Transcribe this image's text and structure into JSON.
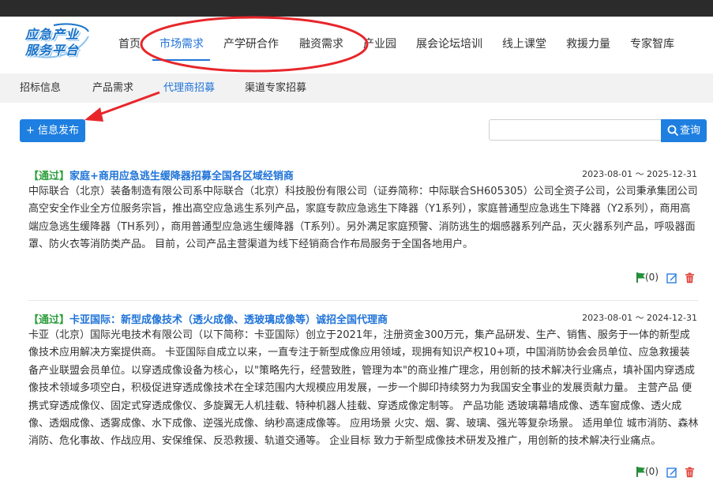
{
  "logo": {
    "line1": "应急产业",
    "line2": "服务平台"
  },
  "nav": {
    "items": [
      {
        "label": "首页"
      },
      {
        "label": "市场需求",
        "active": true
      },
      {
        "label": "产学研合作"
      },
      {
        "label": "融资需求"
      },
      {
        "label": "产业园"
      },
      {
        "label": "展会论坛培训"
      },
      {
        "label": "线上课堂"
      },
      {
        "label": "救援力量"
      },
      {
        "label": "专家智库"
      }
    ]
  },
  "subnav": {
    "items": [
      {
        "label": "招标信息"
      },
      {
        "label": "产品需求"
      },
      {
        "label": "代理商招募",
        "active": true
      },
      {
        "label": "渠道专家招募"
      }
    ]
  },
  "toolbar": {
    "publish_label": "+ 信息发布",
    "search_placeholder": "",
    "search_value": "",
    "search_label": "查询"
  },
  "listings": [
    {
      "status": "【通过】",
      "title": "家庭+商用应急逃生缓降器招募全国各区域经销商",
      "date_range": "2023-08-01 ～ 2025-12-31",
      "description": "中际联合（北京）装备制造有限公司系中际联合（北京）科技股份有限公司（证券简称：中际联合SH605305）公司全资子公司，公司秉承集团公司高空安全作业全方位服务宗旨，推出高空应急逃生系列产品，家庭专款应急逃生下降器（Y1系列），家庭普通型应急逃生下降器（Y2系列），商用高端应急逃生缓降器（TH系列），商用普通型应急逃生缓降器（T系列）。另外满足家庭预警、消防逃生的烟感器系列产品，灭火器系列产品，呼吸器面罩、防火衣等消防类产品。 目前，公司产品主营渠道为线下经销商合作布局服务于全国各地用户。",
      "flag_count": "(0)"
    },
    {
      "status": "【通过】",
      "title": "卡亚国际：新型成像技术（透火成像、透玻璃成像等）诚招全国代理商",
      "date_range": "2023-08-01 ～ 2024-12-31",
      "description": "卡亚（北京）国际光电技术有限公司（以下简称：卡亚国际）创立于2021年，注册资金300万元，集产品研发、生产、销售、服务于一体的新型成像技术应用解决方案提供商。 卡亚国际自成立以来，一直专注于新型成像应用领域，现拥有知识产权10+项，中国消防协会会员单位、应急救援装备产业联盟会员单位。以穿透成像设备为核心，以\"策略先行，经营致胜，管理为本\"的商业推广理念，用创新的技术解决行业痛点，填补国内穿透成像技术领域多项空白，积极促进穿透成像技术在全球范围内大规模应用发展，一步一个脚印持续努力为我国安全事业的发展贡献力量。 主营产品 便携式穿透成像仪、固定式穿透成像仪、多旋翼无人机挂载、特种机器人挂载、穿透成像定制等。 产品功能 透玻璃幕墙成像、透车窗成像、透火成像、透烟成像、透雾成像、水下成像、逆强光成像、纳秒高速成像等。 应用场景 火灾、烟、雾、玻璃、强光等复杂场景。 适用单位 城市消防、森林消防、危化事故、作战应用、安保维保、反恐救援、轨道交通等。 企业目标 致力于新型成像技术研发及推广，用创新的技术解决行业痛点。",
      "flag_count": "(0)"
    }
  ],
  "colors": {
    "accent": "#1e7fe0",
    "link": "#1f73d8",
    "status_green": "#2e9e3e",
    "annotation_red": "#e8262a",
    "delete_red": "#e0443c"
  }
}
